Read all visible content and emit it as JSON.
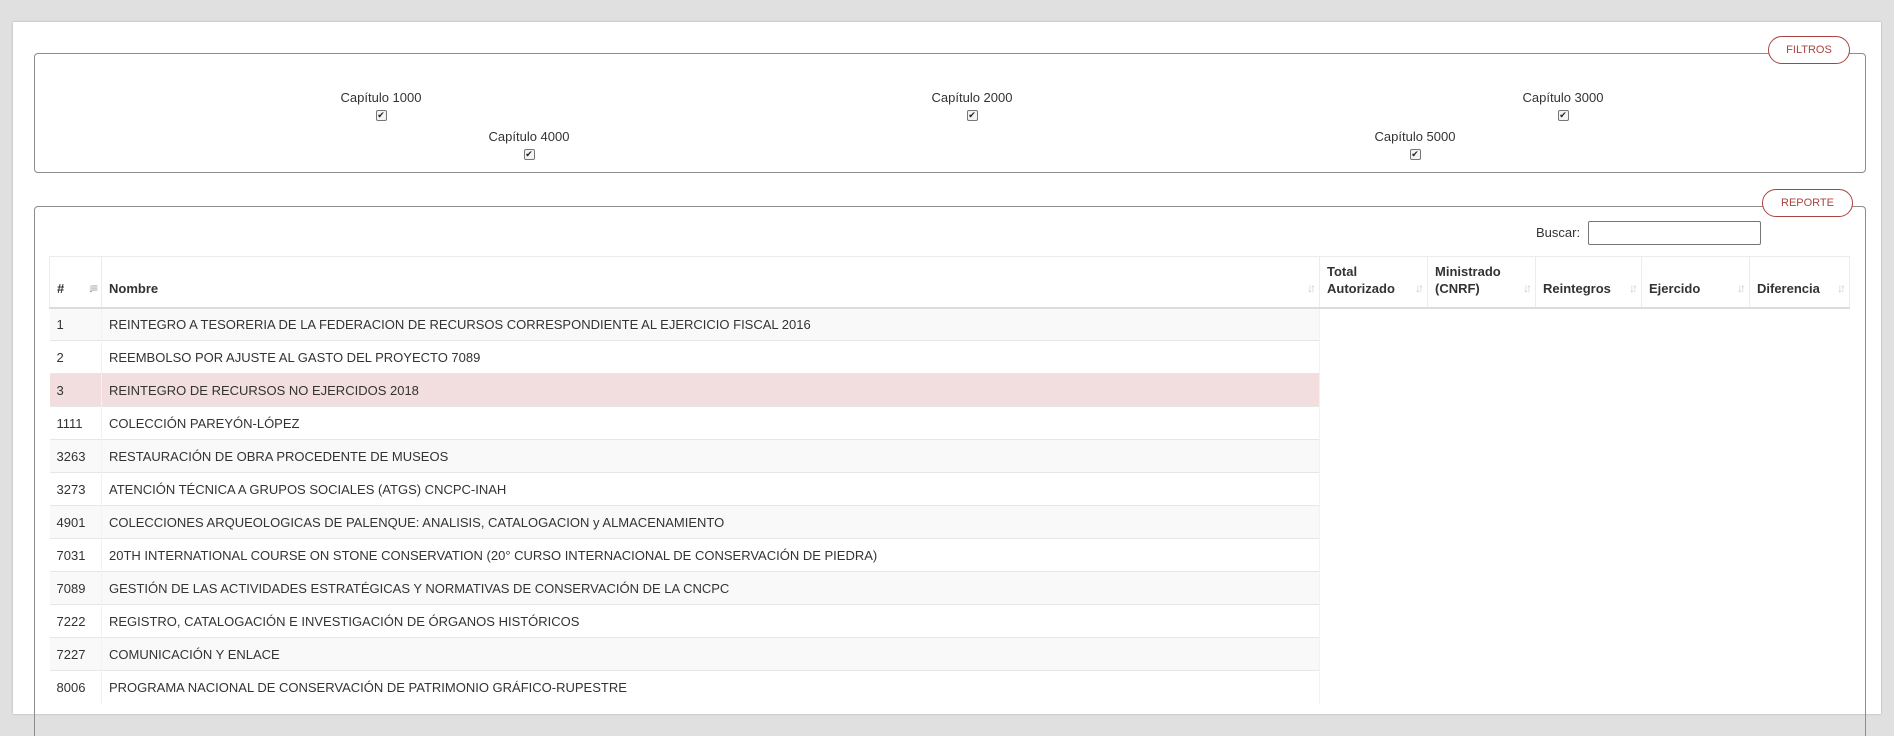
{
  "filters": {
    "button_label": "FILTROS",
    "checkboxes": [
      {
        "label": "Capítulo 1000",
        "checked": true
      },
      {
        "label": "Capítulo 2000",
        "checked": true
      },
      {
        "label": "Capítulo 3000",
        "checked": true
      },
      {
        "label": "Capítulo 4000",
        "checked": true
      },
      {
        "label": "Capítulo 5000",
        "checked": true
      }
    ]
  },
  "report": {
    "button_label": "REPORTE",
    "search_label": "Buscar:",
    "search_value": "",
    "columns": [
      "#",
      "Nombre",
      "Total Autorizado",
      "Ministrado (CNRF)",
      "Reintegros",
      "Ejercido",
      "Diferencia"
    ],
    "rows": [
      {
        "num": "1",
        "name": "REINTEGRO A TESORERIA DE LA FEDERACION DE RECURSOS CORRESPONDIENTE AL EJERCICIO FISCAL 2016"
      },
      {
        "num": "2",
        "name": "REEMBOLSO POR AJUSTE AL GASTO DEL PROYECTO 7089"
      },
      {
        "num": "3",
        "name": "REINTEGRO DE RECURSOS NO EJERCIDOS 2018"
      },
      {
        "num": "1111",
        "name": "COLECCIÓN PAREYÓN-LÓPEZ"
      },
      {
        "num": "3263",
        "name": "RESTAURACIÓN DE OBRA PROCEDENTE DE MUSEOS"
      },
      {
        "num": "3273",
        "name": "ATENCIÓN TÉCNICA A GRUPOS SOCIALES (ATGS) CNCPC-INAH"
      },
      {
        "num": "4901",
        "name": "COLECCIONES ARQUEOLOGICAS DE PALENQUE: ANALISIS, CATALOGACION y ALMACENAMIENTO"
      },
      {
        "num": "7031",
        "name": "20TH INTERNATIONAL COURSE ON STONE CONSERVATION (20° CURSO INTERNACIONAL DE CONSERVACIÓN DE PIEDRA)"
      },
      {
        "num": "7089",
        "name": "GESTIÓN DE LAS ACTIVIDADES ESTRATÉGICAS Y NORMATIVAS DE CONSERVACIÓN DE LA CNCPC"
      },
      {
        "num": "7222",
        "name": "REGISTRO, CATALOGACIÓN E INVESTIGACIÓN DE ÓRGANOS HISTÓRICOS"
      },
      {
        "num": "7227",
        "name": "COMUNICACIÓN Y ENLACE"
      },
      {
        "num": "8006",
        "name": "PROGRAMA NACIONAL DE CONSERVACIÓN DE PATRIMONIO GRÁFICO-RUPESTRE"
      }
    ]
  },
  "colors": {
    "accent": "#a94442",
    "highlight_row": "#f2dede"
  }
}
